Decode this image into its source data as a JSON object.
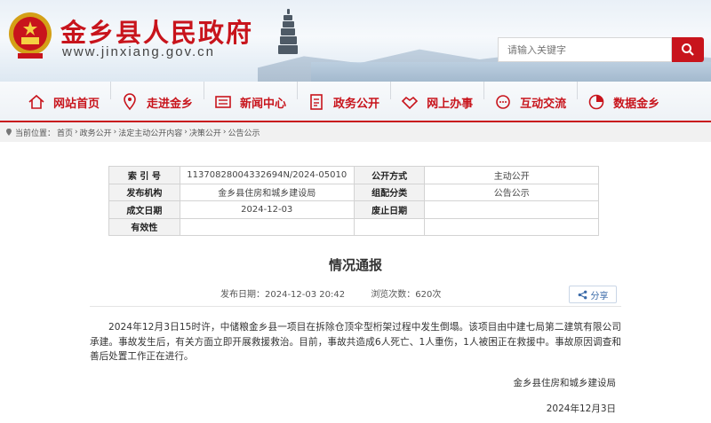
{
  "header": {
    "site_name": "金乡县人民政府",
    "site_url": "www.jinxiang.gov.cn",
    "search": {
      "placeholder": "请输入关键字"
    }
  },
  "nav": {
    "items": [
      {
        "label": "网站首页",
        "icon": "home-icon"
      },
      {
        "label": "走进金乡",
        "icon": "location-pin-icon"
      },
      {
        "label": "新闻中心",
        "icon": "newspaper-icon"
      },
      {
        "label": "政务公开",
        "icon": "document-list-icon"
      },
      {
        "label": "网上办事",
        "icon": "handshake-icon"
      },
      {
        "label": "互动交流",
        "icon": "chat-icon"
      },
      {
        "label": "数据金乡",
        "icon": "data-icon"
      }
    ]
  },
  "breadcrumb": {
    "prefix": "当前位置：",
    "items": [
      "首页",
      "政务公开",
      "法定主动公开内容",
      "决策公开",
      "公告公示"
    ],
    "separator": "›"
  },
  "meta": {
    "index_label": "索 引 号",
    "index_value": "11370828004332694N/2024-05010",
    "disclosure_label": "公开方式",
    "disclosure_value": "主动公开",
    "publisher_label": "发布机构",
    "publisher_value": "金乡县住房和城乡建设局",
    "category_label": "组配分类",
    "category_value": "公告公示",
    "created_label": "成文日期",
    "created_value": "2024-12-03",
    "abolished_label": "废止日期",
    "abolished_value": "",
    "validity_label": "有效性",
    "validity_value": ""
  },
  "article": {
    "title": "情况通报",
    "publish_time": "发布日期：2024-12-03 20:42",
    "views": "浏览次数：620次",
    "share_label": "分享",
    "body": "2024年12月3日15时许，中储粮金乡县一项目在拆除仓顶伞型桁架过程中发生倒塌。该项目由中建七局第二建筑有限公司承建。事故发生后，有关方面立即开展救援救治。目前，事故共造成6人死亡、1人重伤，1人被困正在救援中。事故原因调查和善后处置工作正在进行。",
    "signature": "金乡县住房和城乡建设局",
    "date": "2024年12月3日"
  },
  "colors": {
    "brand_red": "#c8141c"
  }
}
